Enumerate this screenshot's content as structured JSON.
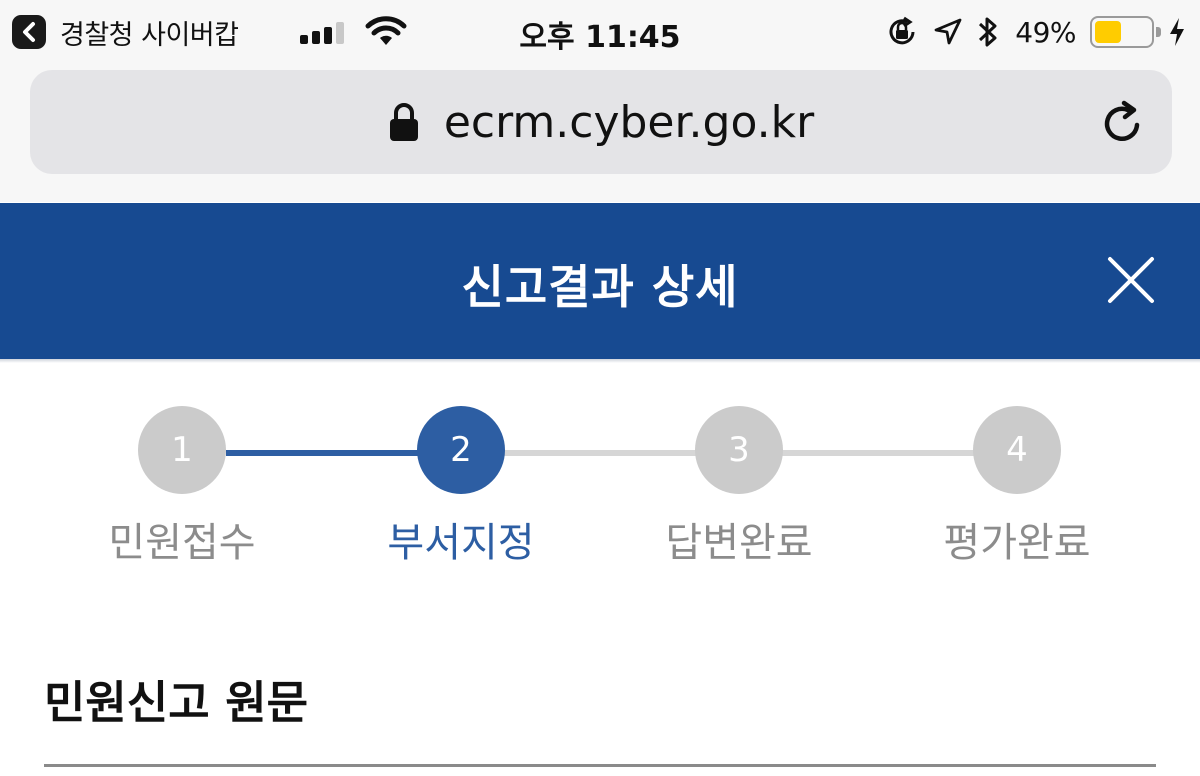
{
  "status_bar": {
    "back_app_label": "경찰청 사이버캅",
    "time": "오후 11:45",
    "battery_percent": "49%",
    "battery_level": 0.49,
    "icons": [
      "back-chevron-icon",
      "signal-icon",
      "wifi-icon",
      "orientation-lock-icon",
      "location-icon",
      "bluetooth-icon",
      "battery-icon",
      "charging-bolt-icon"
    ]
  },
  "browser": {
    "url": "ecrm.cyber.go.kr",
    "icons": [
      "lock-icon",
      "reload-icon"
    ]
  },
  "header": {
    "title": "신고결과 상세",
    "background": "#174a91",
    "close_icon": "close-icon"
  },
  "stepper": {
    "active_color": "#2d5ea3",
    "inactive_color": "#cbcbcb",
    "current_step": 2,
    "steps": [
      {
        "number": "1",
        "label": "민원접수"
      },
      {
        "number": "2",
        "label": "부서지정"
      },
      {
        "number": "3",
        "label": "답변완료"
      },
      {
        "number": "4",
        "label": "평가완료"
      }
    ]
  },
  "section": {
    "title": "민원신고 원문"
  }
}
